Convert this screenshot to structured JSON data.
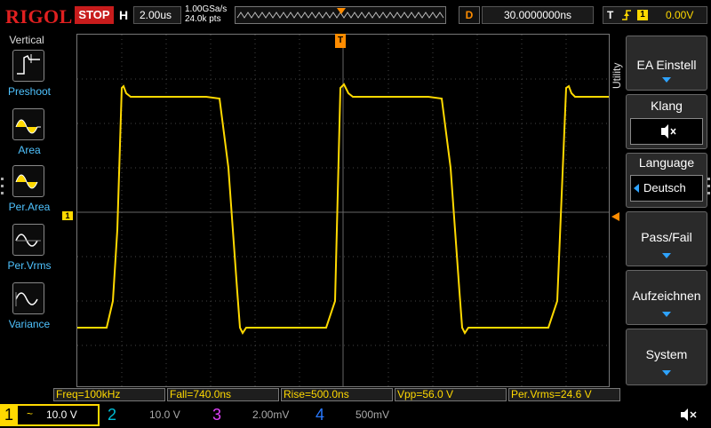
{
  "brand": "RIGOL",
  "run_state": "STOP",
  "horizontal": {
    "key": "H",
    "timebase": "2.00us"
  },
  "acquisition": {
    "sample_rate": "1.00GSa/s",
    "points": "24.0k pts"
  },
  "delay": {
    "key": "D",
    "value": "30.0000000ns"
  },
  "trigger": {
    "key": "T",
    "edge_icon": "rising-edge-icon",
    "source": "1",
    "level": "0.00V"
  },
  "left_panel": {
    "title": "Vertical",
    "items": [
      {
        "label": "Preshoot",
        "icon": "preshoot-icon"
      },
      {
        "label": "Area",
        "icon": "area-icon"
      },
      {
        "label": "Per.Area",
        "icon": "per-area-icon"
      },
      {
        "label": "Per.Vrms",
        "icon": "per-vrms-icon"
      },
      {
        "label": "Variance",
        "icon": "variance-icon"
      }
    ]
  },
  "right_menu": {
    "tab": "Utility",
    "items": [
      {
        "label": "EA Einstell",
        "kind": "arrow"
      },
      {
        "label": "Klang",
        "kind": "speaker",
        "value_icon": "speaker-mute-icon"
      },
      {
        "label": "Language",
        "kind": "select",
        "value": "Deutsch"
      },
      {
        "label": "Pass/Fail",
        "kind": "arrow"
      },
      {
        "label": "Aufzeichnen",
        "kind": "arrow"
      },
      {
        "label": "System",
        "kind": "arrow"
      }
    ]
  },
  "markers": {
    "ch1": "1"
  },
  "measurements": [
    "Freq=100kHz",
    "Fall=740.0ns",
    "Rise=500.0ns",
    "Vpp=56.0 V",
    "Per.Vrms=24.6 V"
  ],
  "channels": [
    {
      "num": "1",
      "coupling": "~",
      "scale": "10.0 V",
      "color": "#ffd900",
      "active": true
    },
    {
      "num": "2",
      "coupling": "",
      "scale": "10.0 V",
      "color": "#00bcd4",
      "active": false
    },
    {
      "num": "3",
      "coupling": "",
      "scale": "2.00mV",
      "color": "#e040fb",
      "active": false
    },
    {
      "num": "4",
      "coupling": "",
      "scale": "500mV",
      "color": "#2979ff",
      "active": false
    }
  ],
  "colors": {
    "ch1": "#ffd900",
    "accent": "#2ea3ff",
    "stop": "#c81c1c",
    "trigger": "#ff8c00"
  }
}
